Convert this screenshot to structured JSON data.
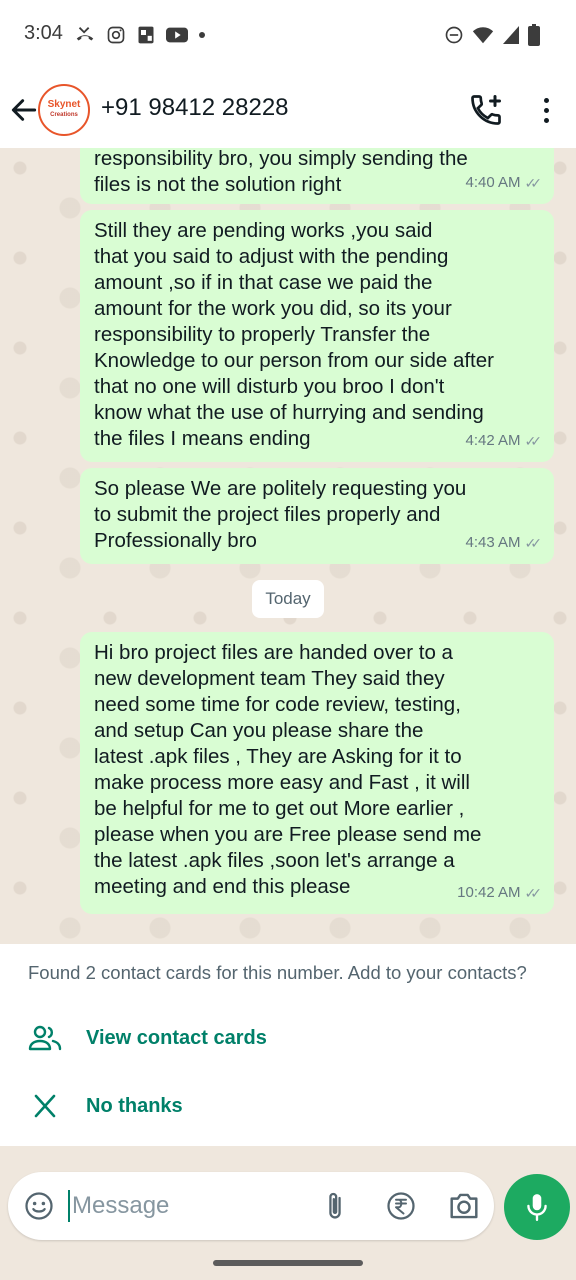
{
  "status_bar": {
    "time": "3:04",
    "left_icons": [
      "missed-call-icon",
      "instagram-icon",
      "photo-app-icon",
      "youtube-icon",
      "dot-icon"
    ],
    "right_icons": [
      "do-not-disturb-icon",
      "wifi-icon",
      "signal-icon",
      "battery-icon"
    ]
  },
  "header": {
    "avatar_text": "Skynet",
    "avatar_subtext": "Creations",
    "contact_name": "+91 98412 28228"
  },
  "messages": [
    {
      "text": "responsibility bro, you simply sending the\nfiles is not the solution right",
      "time": "4:40 AM"
    },
    {
      "text": "Still they are pending works ,you said\nthat you said to adjust with the pending\namount ,so if in that case we paid the\namount for the work you did, so its your\nresponsibility to properly Transfer the\nKnowledge to our person from our side after\nthat no one will disturb you  broo I don't\nknow what the use of hurrying and sending\nthe files I means ending",
      "time": "4:42 AM"
    },
    {
      "text": "So please We are politely requesting you\nto submit the project files properly and\nProfessionally bro",
      "time": "4:43 AM"
    },
    {
      "text": "Hi bro  project files are handed  over to a\nnew development team They  said they\nneed some time for code review, testing,\nand setup Can you please share the\nlatest .apk files ,  They are  Asking for it to\nmake process more easy and Fast , it will\nbe helpful for me to get out More earlier ,\nplease when you are Free please send me\nthe latest .apk files ,soon let's arrange a\nmeeting and end this please",
      "time": "10:42 AM"
    }
  ],
  "date_chip": "Today",
  "contact_panel": {
    "prompt": "Found 2 contact cards for this number. Add to your contacts?",
    "view_label": "View contact cards",
    "dismiss_label": "No thanks"
  },
  "composer": {
    "placeholder": "Message"
  },
  "colors": {
    "accent": "#008069",
    "outgoing_bubble": "#d9fdd3",
    "mic_button": "#1daa61"
  }
}
